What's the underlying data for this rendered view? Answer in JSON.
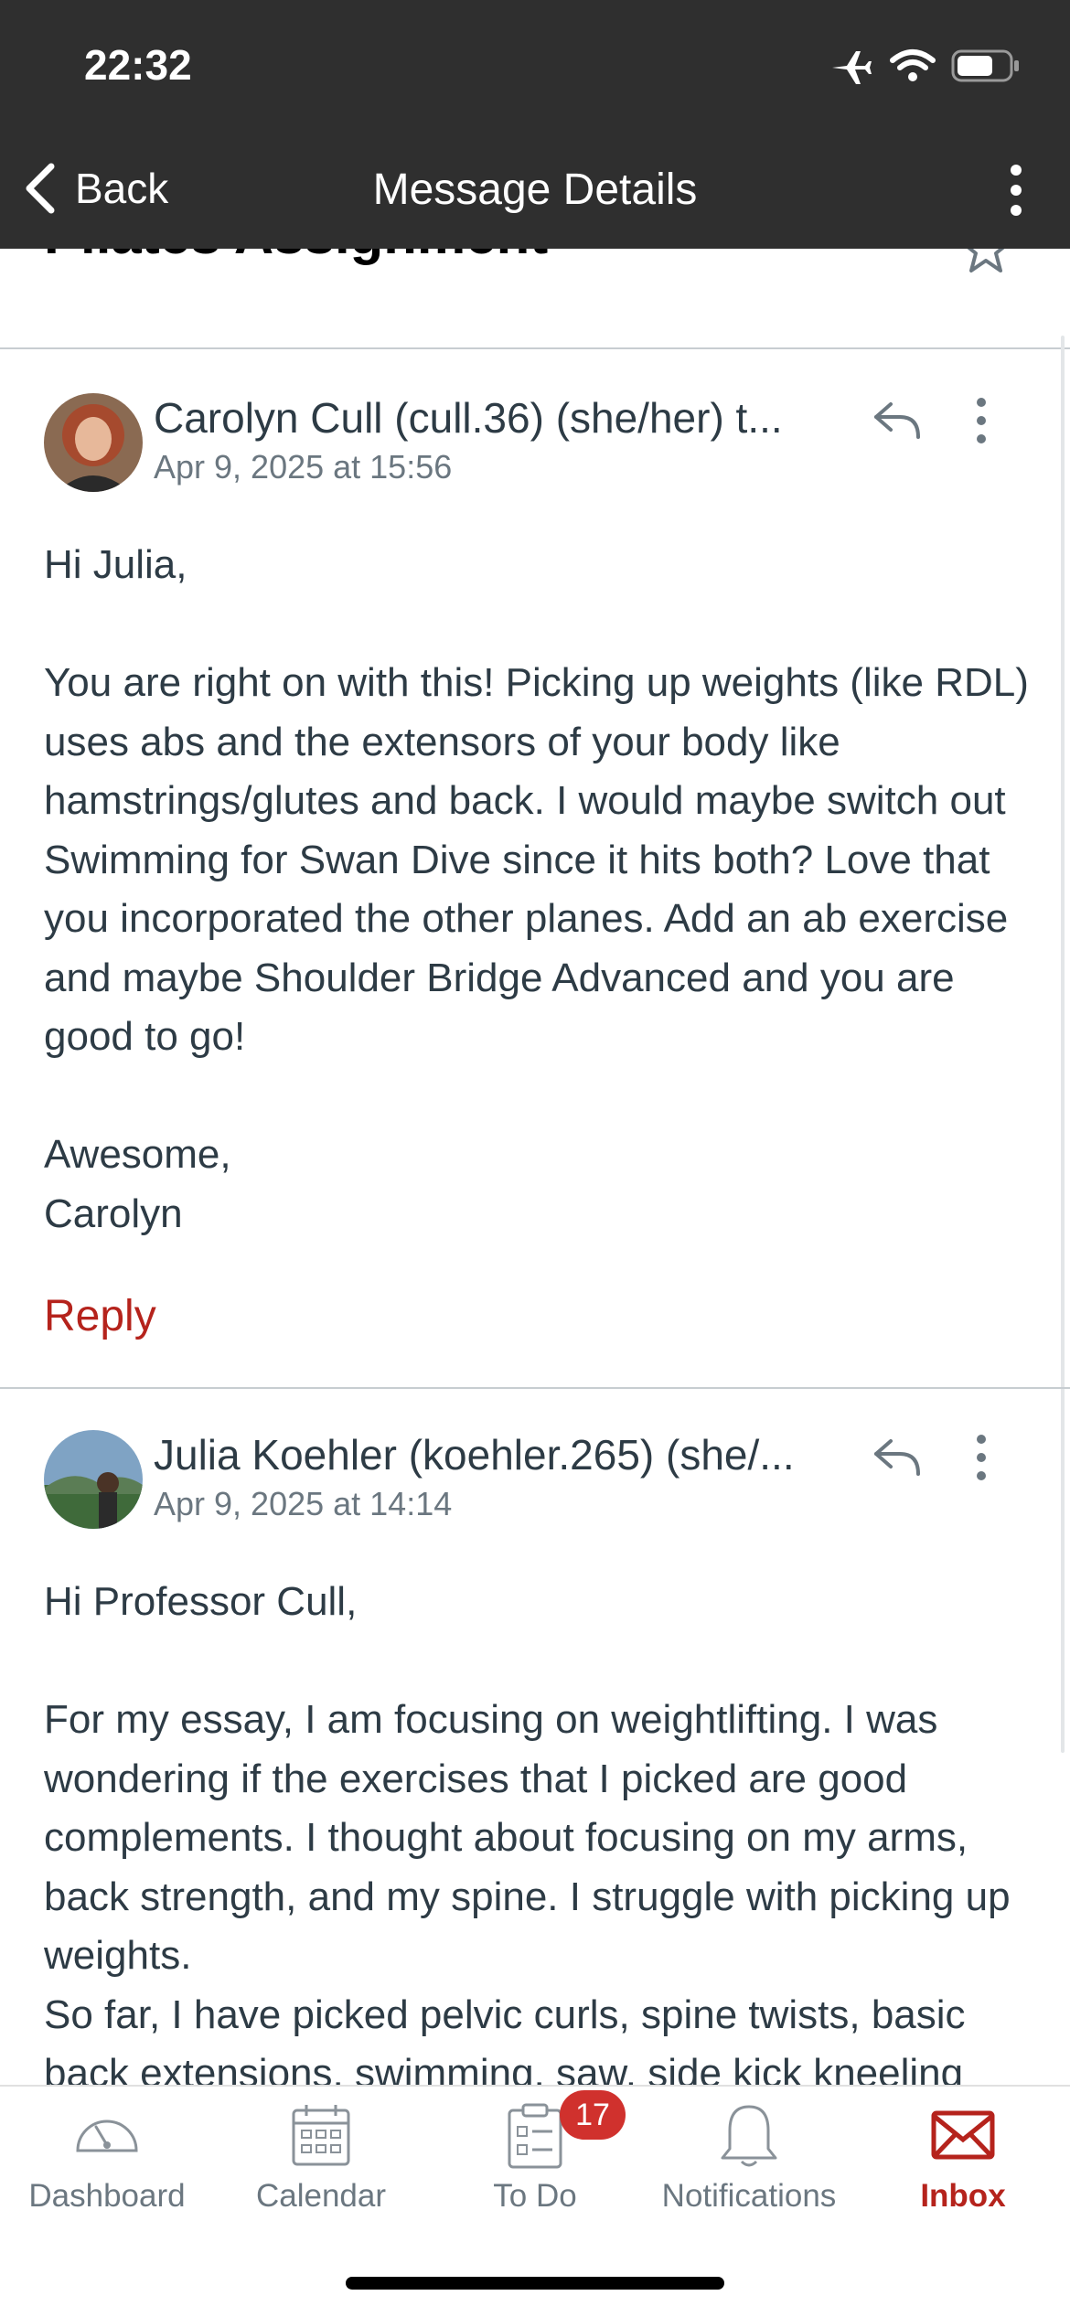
{
  "status_bar": {
    "time": "22:32"
  },
  "nav": {
    "back_label": "Back",
    "title": "Message Details"
  },
  "conversation": {
    "subject": "Pilates Assignment"
  },
  "messages": [
    {
      "author": "Carolyn Cull (cull.36) (she/her) t...",
      "date": "Apr 9, 2025 at 15:56",
      "body": [
        "Hi Julia,",
        "",
        "You are right on with this!  Picking up weights (like RDL) uses abs and the extensors of your body like hamstrings/glutes and back.  I would maybe switch out Swimming for Swan Dive since it hits both? Love that you incorporated the other planes.  Add an ab exercise and maybe Shoulder Bridge Advanced and you are good to go!",
        "",
        "Awesome,",
        "Carolyn"
      ],
      "reply_label": "Reply"
    },
    {
      "author": "Julia Koehler (koehler.265) (she/...",
      "date": "Apr 9, 2025 at 14:14",
      "body": [
        "Hi Professor Cull,",
        "",
        "For my essay, I am focusing on weightlifting. I was wondering if the exercises that I picked are good complements. I thought about focusing on my arms, back strength, and my spine. I struggle with picking up weights.",
        "So far, I have picked pelvic curls, spine twists, basic back extensions, swimming, saw, side kick kneeling"
      ]
    }
  ],
  "tabbar": {
    "tabs": [
      {
        "label": "Dashboard",
        "icon": "dashboard-icon"
      },
      {
        "label": "Calendar",
        "icon": "calendar-icon"
      },
      {
        "label": "To Do",
        "icon": "todo-icon",
        "badge": "17"
      },
      {
        "label": "Notifications",
        "icon": "bell-icon"
      },
      {
        "label": "Inbox",
        "icon": "inbox-icon",
        "active": true
      }
    ]
  },
  "colors": {
    "accent": "#b5231c",
    "header": "#2f2f2f",
    "badge": "#d0312d"
  }
}
